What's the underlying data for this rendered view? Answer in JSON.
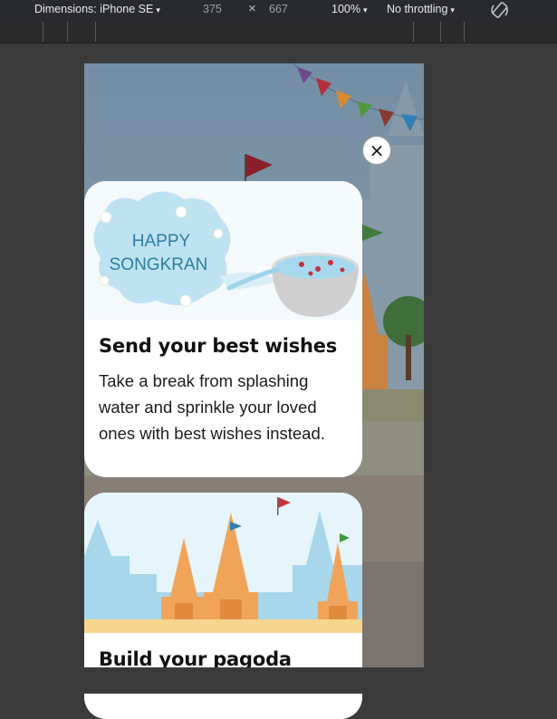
{
  "devtools": {
    "device_label": "Dimensions: iPhone SE",
    "width": "375",
    "times": "×",
    "height": "667",
    "zoom": "100%",
    "throttling": "No throttling",
    "caret": "▾",
    "rotate_icon": "rotate-icon"
  },
  "modal": {
    "close_symbol": "×",
    "cards": [
      {
        "illustration_text_line1": "HAPPY",
        "illustration_text_line2": "SONGKRAN",
        "title": "Send your best wishes",
        "description": "Take a break from splashing water and sprinkle your loved ones with best wishes instead."
      },
      {
        "title": "Build your pagoda"
      }
    ]
  },
  "colors": {
    "toolbar_bg": "#292a2d",
    "backdrop": "#3a3a3a",
    "sky": "#7b93a6",
    "pagoda": "#e7a05a",
    "water": "#cfe9f6"
  }
}
